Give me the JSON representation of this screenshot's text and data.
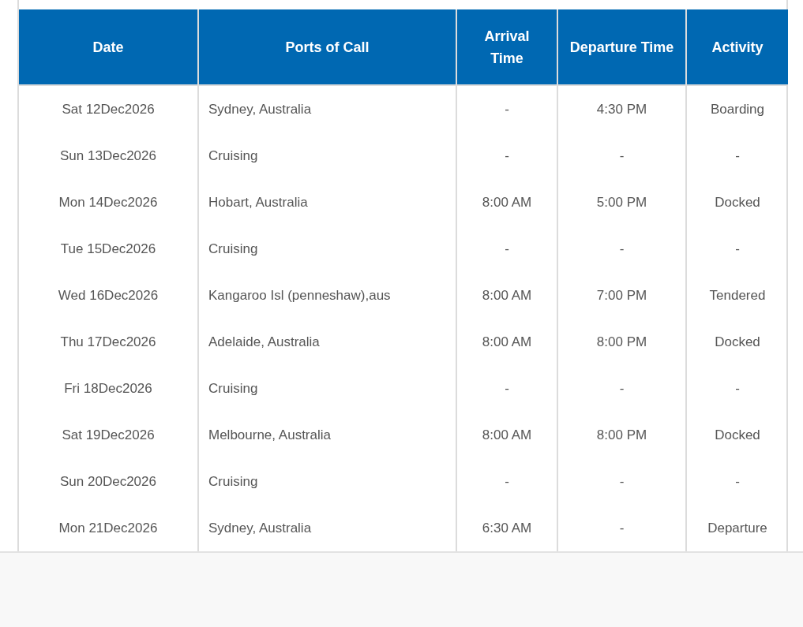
{
  "table": {
    "columns": [
      "Date",
      "Ports of Call",
      "Arrival Time",
      "Departure Time",
      "Activity"
    ],
    "rows": [
      [
        "Sat 12Dec2026",
        "Sydney, Australia",
        "-",
        "4:30 PM",
        "Boarding"
      ],
      [
        "Sun 13Dec2026",
        "Cruising",
        "-",
        "-",
        "-"
      ],
      [
        "Mon 14Dec2026",
        "Hobart, Australia",
        "8:00 AM",
        "5:00 PM",
        "Docked"
      ],
      [
        "Tue 15Dec2026",
        "Cruising",
        "-",
        "-",
        "-"
      ],
      [
        "Wed 16Dec2026",
        "Kangaroo Isl (penneshaw),aus",
        "8:00 AM",
        "7:00 PM",
        "Tendered"
      ],
      [
        "Thu 17Dec2026",
        "Adelaide, Australia",
        "8:00 AM",
        "8:00 PM",
        "Docked"
      ],
      [
        "Fri 18Dec2026",
        "Cruising",
        "-",
        "-",
        "-"
      ],
      [
        "Sat 19Dec2026",
        "Melbourne, Australia",
        "8:00 AM",
        "8:00 PM",
        "Docked"
      ],
      [
        "Sun 20Dec2026",
        "Cruising",
        "-",
        "-",
        "-"
      ],
      [
        "Mon 21Dec2026",
        "Sydney, Australia",
        "6:30 AM",
        "-",
        "Departure"
      ]
    ]
  }
}
